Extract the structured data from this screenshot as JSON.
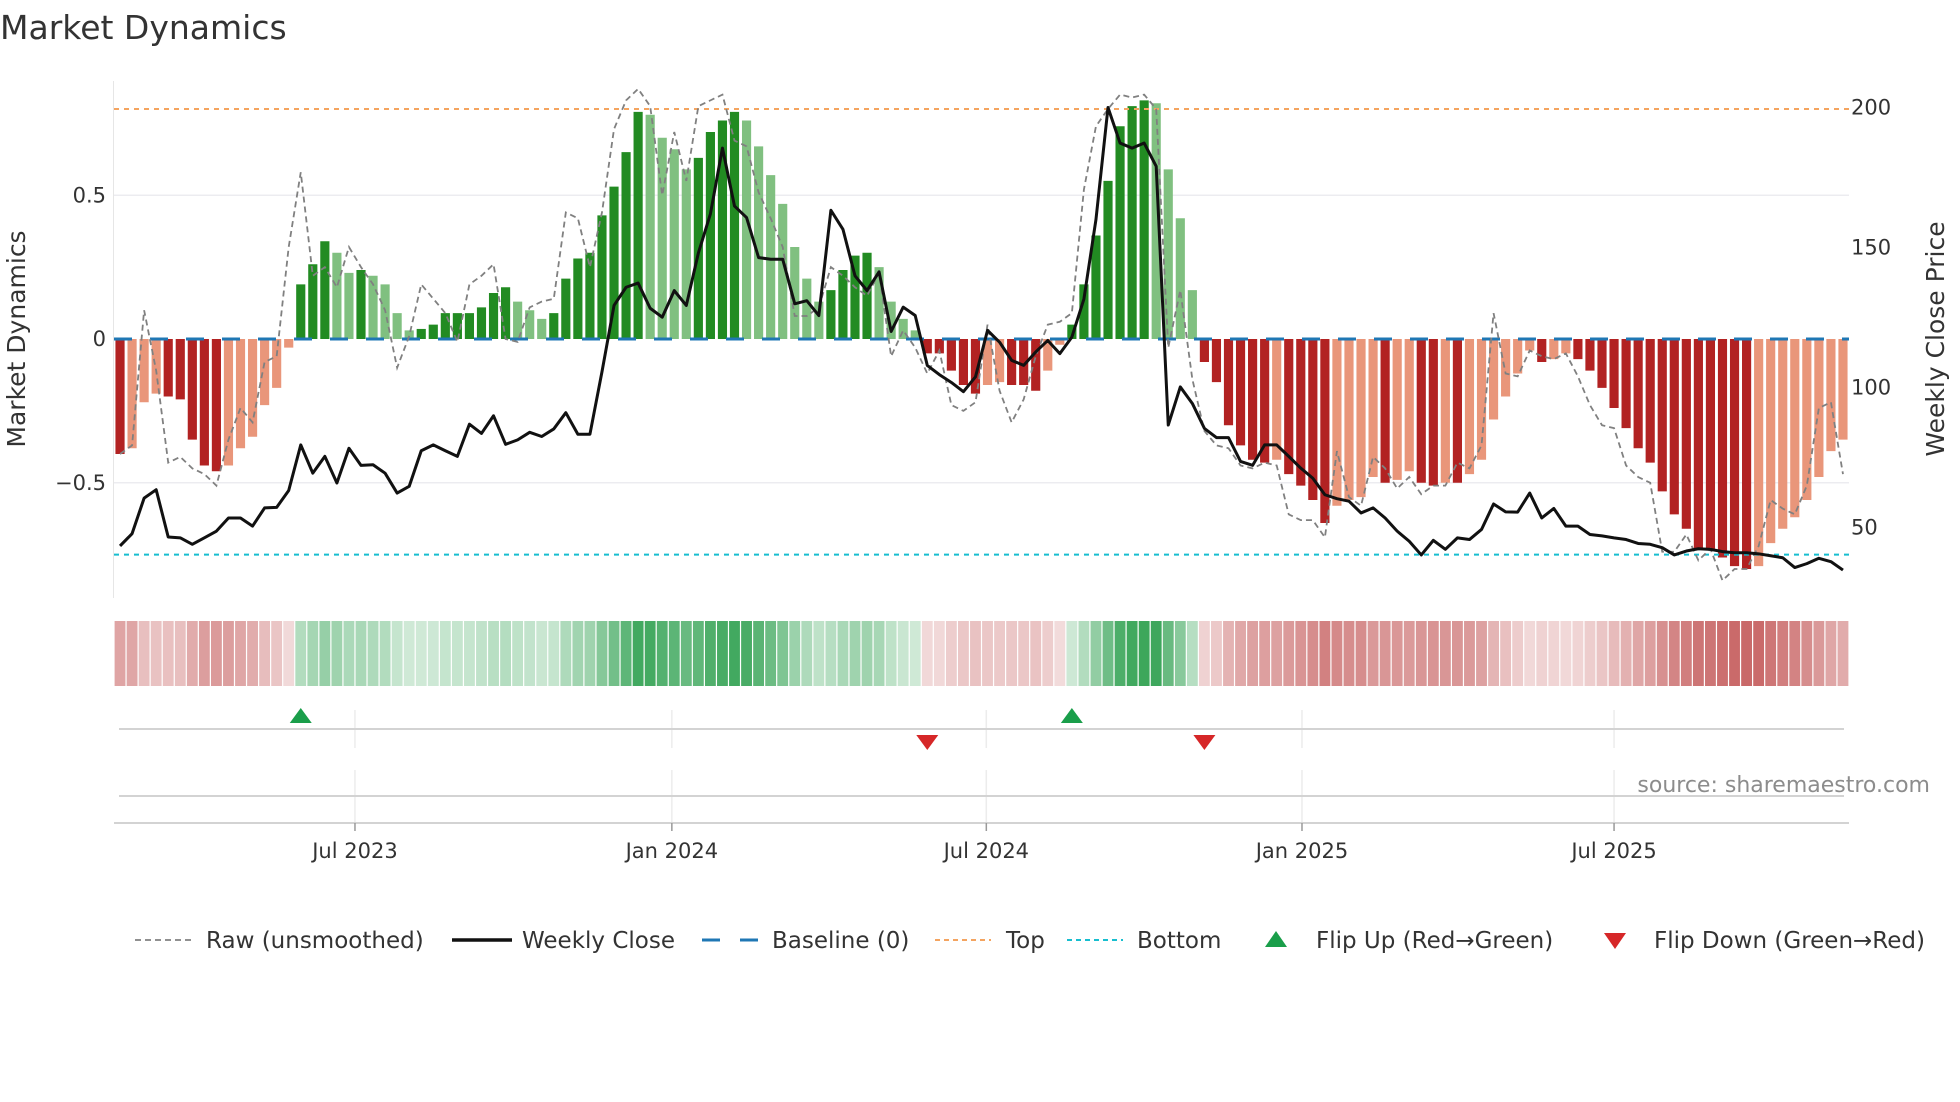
{
  "title": "Market Dynamics",
  "source": "source: sharemaestro.com",
  "colors": {
    "green_strong": "#228b22",
    "green_weak": "#80c080",
    "red_strong": "#b22222",
    "red_weak": "#e9967a",
    "price": "#111111",
    "raw": "#808080",
    "baseline": "#1f77b4",
    "top": "#f4a460",
    "bottom": "#17becf",
    "flip_up": "#1a9e4a",
    "flip_down": "#d62728",
    "heat_green": "#2ea04f",
    "heat_red": "#c45a5a"
  },
  "chart_data": {
    "type": "bar",
    "title": "Market Dynamics",
    "ylabel": "Market Dynamics",
    "y2label": "Weekly Close Price",
    "ylim": [
      -0.92,
      0.92
    ],
    "y2lim": [
      25,
      210
    ],
    "yticks": [
      {
        "value": 0.5,
        "label": "0.5"
      },
      {
        "value": 0,
        "label": "0"
      },
      {
        "value": -0.5,
        "label": "−0.5"
      }
    ],
    "y2ticks": [
      {
        "value": 200,
        "label": "200"
      },
      {
        "value": 150,
        "label": "150"
      },
      {
        "value": 100,
        "label": "100"
      },
      {
        "value": 50,
        "label": "50"
      }
    ],
    "x_ticks": [
      {
        "week": 20,
        "label": "Jul 2023"
      },
      {
        "week": 46.3,
        "label": "Jan 2024"
      },
      {
        "week": 72.4,
        "label": "Jul 2024"
      },
      {
        "week": 98.6,
        "label": "Jan 2025"
      },
      {
        "week": 124.5,
        "label": "Jul 2025"
      }
    ],
    "top_level": 0.8,
    "bottom_level": -0.75,
    "baseline": 0,
    "momentum": [
      -0.4,
      -0.38,
      -0.22,
      -0.19,
      -0.2,
      -0.21,
      -0.35,
      -0.44,
      -0.46,
      -0.44,
      -0.38,
      -0.34,
      -0.23,
      -0.17,
      -0.03,
      0.19,
      0.26,
      0.34,
      0.3,
      0.23,
      0.24,
      0.22,
      0.19,
      0.09,
      0.03,
      0.035,
      0.05,
      0.09,
      0.09,
      0.09,
      0.11,
      0.16,
      0.18,
      0.13,
      0.1,
      0.07,
      0.09,
      0.21,
      0.28,
      0.3,
      0.43,
      0.53,
      0.65,
      0.79,
      0.78,
      0.7,
      0.66,
      0.59,
      0.63,
      0.72,
      0.76,
      0.79,
      0.76,
      0.67,
      0.57,
      0.47,
      0.32,
      0.21,
      0.13,
      0.17,
      0.24,
      0.29,
      0.3,
      0.25,
      0.13,
      0.07,
      0.03,
      -0.05,
      -0.05,
      -0.11,
      -0.16,
      -0.19,
      -0.16,
      -0.15,
      -0.16,
      -0.16,
      -0.18,
      -0.11,
      -0.02,
      0.05,
      0.19,
      0.36,
      0.55,
      0.74,
      0.81,
      0.83,
      0.82,
      0.59,
      0.42,
      0.17,
      -0.08,
      -0.15,
      -0.3,
      -0.37,
      -0.42,
      -0.43,
      -0.42,
      -0.47,
      -0.51,
      -0.56,
      -0.64,
      -0.58,
      -0.56,
      -0.55,
      -0.48,
      -0.5,
      -0.49,
      -0.46,
      -0.5,
      -0.51,
      -0.5,
      -0.5,
      -0.47,
      -0.42,
      -0.28,
      -0.2,
      -0.12,
      -0.04,
      -0.08,
      -0.07,
      -0.05,
      -0.07,
      -0.11,
      -0.17,
      -0.24,
      -0.31,
      -0.38,
      -0.43,
      -0.53,
      -0.61,
      -0.66,
      -0.73,
      -0.73,
      -0.76,
      -0.79,
      -0.8,
      -0.79,
      -0.71,
      -0.66,
      -0.62,
      -0.56,
      -0.48,
      -0.39,
      -0.35
    ],
    "raw": [
      -0.4,
      -0.37,
      0.1,
      -0.11,
      -0.43,
      -0.41,
      -0.45,
      -0.47,
      -0.51,
      -0.35,
      -0.24,
      -0.29,
      -0.08,
      -0.06,
      0.32,
      0.58,
      0.22,
      0.25,
      0.18,
      0.32,
      0.25,
      0.19,
      0.1,
      -0.1,
      0.01,
      0.19,
      0.14,
      0.09,
      -0.01,
      0.19,
      0.22,
      0.26,
      0.0,
      -0.01,
      0.11,
      0.13,
      0.14,
      0.44,
      0.42,
      0.25,
      0.44,
      0.73,
      0.83,
      0.87,
      0.81,
      0.5,
      0.72,
      0.55,
      0.81,
      0.83,
      0.85,
      0.69,
      0.67,
      0.51,
      0.42,
      0.32,
      0.08,
      0.08,
      0.11,
      0.25,
      0.22,
      0.18,
      0.15,
      0.23,
      -0.06,
      0.03,
      -0.03,
      -0.12,
      -0.04,
      -0.23,
      -0.25,
      -0.22,
      0.05,
      -0.18,
      -0.29,
      -0.21,
      -0.06,
      0.05,
      0.06,
      0.09,
      0.52,
      0.74,
      0.8,
      0.85,
      0.84,
      0.85,
      0.8,
      -0.03,
      0.17,
      -0.14,
      -0.32,
      -0.37,
      -0.38,
      -0.44,
      -0.45,
      -0.43,
      -0.44,
      -0.61,
      -0.63,
      -0.63,
      -0.69,
      -0.39,
      -0.55,
      -0.58,
      -0.41,
      -0.45,
      -0.52,
      -0.48,
      -0.54,
      -0.51,
      -0.51,
      -0.43,
      -0.45,
      -0.37,
      0.09,
      -0.12,
      -0.13,
      -0.04,
      -0.06,
      -0.07,
      -0.05,
      -0.13,
      -0.23,
      -0.3,
      -0.31,
      -0.44,
      -0.48,
      -0.5,
      -0.74,
      -0.74,
      -0.68,
      -0.77,
      -0.73,
      -0.84,
      -0.8,
      -0.8,
      -0.72,
      -0.56,
      -0.59,
      -0.61,
      -0.51,
      -0.24,
      -0.22,
      -0.47
    ],
    "weekly_close": [
      43.4,
      47.8,
      60.5,
      63.5,
      46.6,
      46.3,
      44.0,
      46.3,
      48.7,
      53.4,
      53.4,
      50.5,
      57.0,
      57.2,
      63.2,
      79.5,
      69.4,
      75.4,
      65.9,
      78.3,
      72.2,
      72.4,
      69.4,
      62.3,
      64.7,
      77.4,
      79.5,
      77.4,
      75.4,
      86.9,
      83.6,
      89.9,
      79.7,
      81.3,
      84.0,
      82.5,
      85.2,
      91.0,
      83.3,
      83.3,
      105.6,
      129.3,
      135.8,
      137.3,
      128.3,
      125.1,
      134.6,
      129.3,
      148.0,
      162.0,
      185.5,
      164.8,
      160.7,
      146.4,
      145.8,
      145.8,
      129.9,
      131.0,
      125.7,
      163.3,
      156.5,
      139.9,
      134.6,
      141.3,
      120.0,
      128.7,
      125.7,
      107.9,
      104.6,
      101.8,
      98.5,
      103.8,
      120.4,
      116.2,
      109.7,
      107.9,
      112.7,
      116.8,
      112.1,
      118.0,
      131.6,
      160.0,
      200.0,
      187.3,
      185.5,
      187.3,
      179.0,
      86.6,
      100.2,
      94.3,
      85.4,
      82.1,
      82.1,
      73.6,
      72.2,
      79.5,
      79.5,
      75.4,
      71.2,
      67.6,
      61.7,
      60.3,
      59.4,
      55.2,
      57.0,
      53.4,
      48.7,
      45.1,
      40.2,
      45.4,
      42.2,
      46.3,
      45.7,
      49.3,
      58.4,
      55.6,
      55.5,
      62.3,
      53.4,
      56.8,
      50.5,
      50.5,
      47.5,
      47.0,
      46.3,
      45.7,
      44.3,
      44.0,
      42.8,
      40.2,
      41.6,
      42.4,
      42.2,
      41.4,
      41.0,
      41.0,
      40.6,
      39.9,
      39.2,
      35.7,
      37.1,
      39.0,
      37.8,
      34.8
    ],
    "flips": [
      {
        "week": 15,
        "type": "up"
      },
      {
        "week": 67,
        "type": "down"
      },
      {
        "week": 79,
        "type": "up"
      },
      {
        "week": 90,
        "type": "down"
      }
    ],
    "legend": [
      {
        "label": "Raw (unsmoothed)",
        "kind": "raw"
      },
      {
        "label": "Weekly Close",
        "kind": "price"
      },
      {
        "label": "Baseline (0)",
        "kind": "baseline"
      },
      {
        "label": "Top",
        "kind": "top"
      },
      {
        "label": "Bottom",
        "kind": "bottom"
      },
      {
        "label": "Flip Up (Red→Green)",
        "kind": "flip_up"
      },
      {
        "label": "Flip Down (Green→Red)",
        "kind": "flip_down"
      }
    ],
    "legend_position": "bottom"
  }
}
